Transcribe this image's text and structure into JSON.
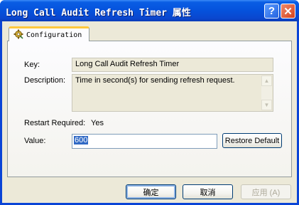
{
  "window": {
    "title": "Long Call Audit Refresh Timer 属性",
    "help_glyph": "?",
    "close_glyph": "✕"
  },
  "tabs": [
    {
      "label": "Configuration",
      "icon": "gear-settings-icon",
      "selected": true
    }
  ],
  "fields": {
    "key_label": "Key:",
    "key_value": "Long Call Audit Refresh Timer",
    "description_label": "Description:",
    "description_value": "Time in second(s) for sending refresh request.",
    "restart_label": "Restart Required:",
    "restart_value": "Yes",
    "value_label": "Value:",
    "value_value": "600",
    "restore_default_label": "Restore Default"
  },
  "footer": {
    "ok_label": "确定",
    "cancel_label": "取消",
    "apply_label": "应用 (A)"
  },
  "colors": {
    "titlebar": "#0552dc",
    "dialog_bg": "#ece9d8",
    "tab_accent": "#ffc83c",
    "selection": "#316ac5"
  }
}
